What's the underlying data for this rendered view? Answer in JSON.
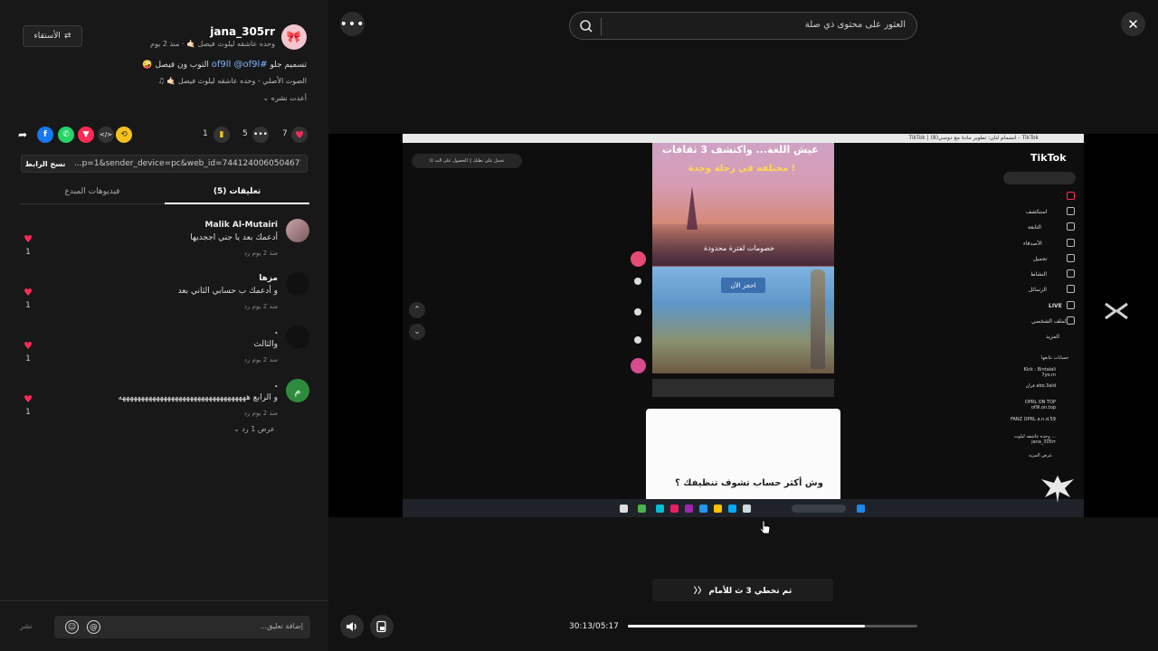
{
  "post": {
    "username": "jana_305rr",
    "subline": "وحده عاشقه ليلوث فيصل 🤙🏻 · منذ 2 يوم",
    "report_label": "الأستقاء",
    "caption_prefix": "تسميم جلو ",
    "caption_tags": "#of9ll @of9l",
    "caption_suffix": " التوب ون فيصل 🤪",
    "sound": "الصوت الأصلي - وحده عاشقه ليلوث فيصل 🤙🏻",
    "reposted": "أعدت نشره",
    "likes": "7",
    "comments": "5",
    "saves": "1",
    "copy_link_label": "نسخ الرابط",
    "link": "...p=1&sender_device=pc&web_id=7441240060504671752"
  },
  "tabs": {
    "comments": "تعليقات (5)",
    "creator_videos": "فيديوهات المبدع"
  },
  "comments": [
    {
      "name": "Malik Al-Mutairi",
      "text": "أدعمك بعد يا جني اججديها",
      "meta": "منذ 2 يوم    رد",
      "likes": "1"
    },
    {
      "name": "مزها",
      "text": "و أدعمك ب حسابي الثاني بعد",
      "meta": "منذ 2 يوم    رد",
      "likes": "1"
    },
    {
      "name": ".",
      "text": "والثالث",
      "meta": "منذ 2 يوم    رد",
      "likes": "1"
    },
    {
      "name": ".",
      "text": "و الرابع ههههههههههههههههههههههههههههههههههه",
      "meta": "منذ 2 يوم    رد",
      "likes": "1"
    }
  ],
  "view_replies": "عرض 1 رد ⌄",
  "comment_bar": {
    "placeholder": "إضافة تعليق...",
    "post": "نشر"
  },
  "search": {
    "placeholder": "العثور على محتوى ذي صلة"
  },
  "player": {
    "skip_label": "تم تخطي 3 ث للأمام 〈〈",
    "time": "30:13/05:17",
    "progress_fraction": 0.82
  },
  "video_frame": {
    "browser_title": "TikTok | انضمام لنان: تطوير مادة مع دوسي(8) - TikTok",
    "tiktok_logo": "TikTok",
    "pill_text": "⊙ تحمل على تطبك   ▯ الحصول على الت",
    "menu": [
      "",
      "استكشف",
      "التابعة",
      "الأصدقاء",
      "تحميل",
      "النشاط",
      "الرسائل",
      "LIVE",
      "الملف الشخصي",
      "المزيد"
    ],
    "following_header": "حسابات تتابعها",
    "following": [
      "Kick : Bintalali 7yo.m",
      "فران abo.3aid",
      "OPRL ON TOP of9l.on.top",
      "FANZ OPRL a.n.d.59",
      "وحده عاشقه ليلوث ... jana_305rr",
      "عرض المزيد"
    ],
    "clip_title": "عيش اللغة... واكتشف 3 ثقافات",
    "clip_subtitle": "مختلفة في رحلة وحدة !",
    "clip_offer": "خصومات لفترة محدودة",
    "clip_button": "احجز الآن",
    "clip_bottom": "وش أكثر حساب تشوف تنظيفك ؟"
  },
  "colors": {
    "accent": "#fe2c55",
    "background": "#121212",
    "panel": "#181818",
    "link_tag": "#7fb6ff"
  }
}
